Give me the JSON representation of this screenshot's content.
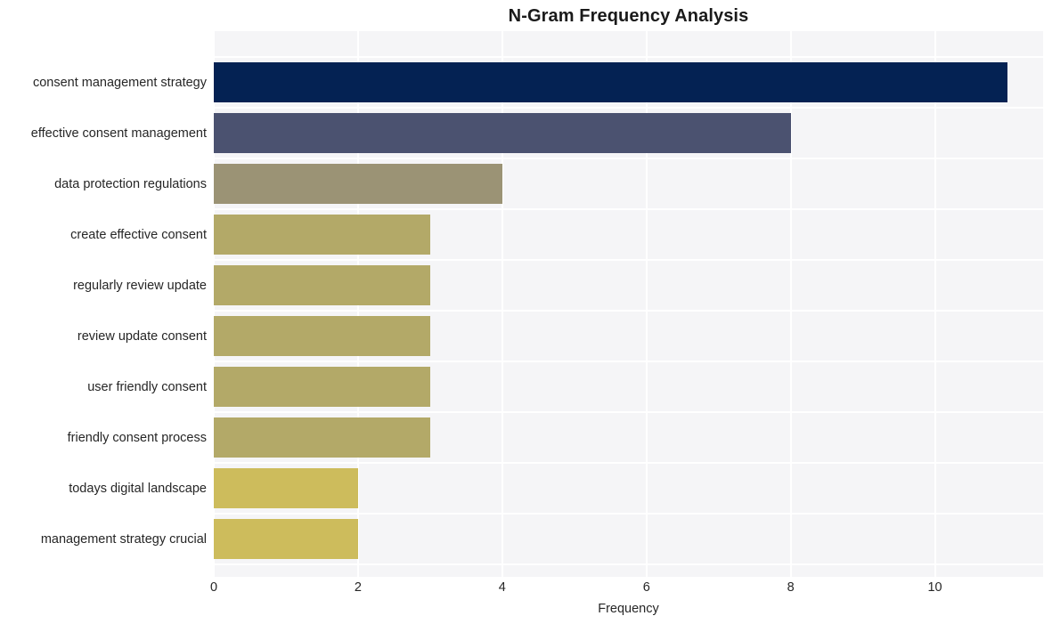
{
  "chart_data": {
    "type": "bar",
    "orientation": "horizontal",
    "title": "N-Gram Frequency Analysis",
    "xlabel": "Frequency",
    "ylabel": "",
    "categories": [
      "consent management strategy",
      "effective consent management",
      "data protection regulations",
      "create effective consent",
      "regularly review update",
      "review update consent",
      "user friendly consent",
      "friendly consent process",
      "todays digital landscape",
      "management strategy crucial"
    ],
    "values": [
      11,
      8,
      4,
      3,
      3,
      3,
      3,
      3,
      2,
      2
    ],
    "bar_colors": [
      "#042253",
      "#4b5270",
      "#9b9375",
      "#b3a968",
      "#b3a968",
      "#b3a968",
      "#b3a968",
      "#b3a968",
      "#cdbc5c",
      "#cdbc5c"
    ],
    "xlim": [
      0,
      11.5
    ],
    "xticks": [
      0,
      2,
      4,
      6,
      8,
      10
    ],
    "xtick_labels": [
      "0",
      "2",
      "4",
      "6",
      "8",
      "10"
    ],
    "grid": true,
    "grid_color": "#ffffff",
    "plot_background": "#f5f5f7",
    "figure_background": "#ffffff",
    "legend": null
  }
}
